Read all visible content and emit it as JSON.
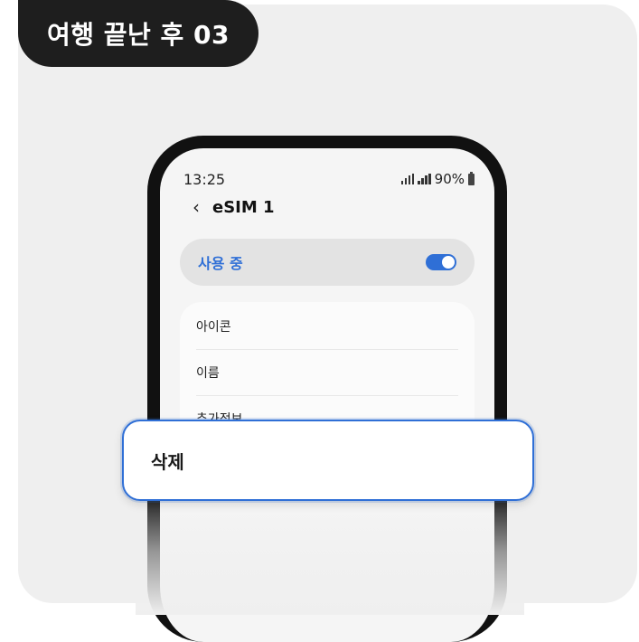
{
  "badge": {
    "text": "여행 끝난 후 03"
  },
  "phone": {
    "status": {
      "time": "13:25",
      "battery": "90%"
    },
    "header": {
      "back_icon": "chevron-left-icon",
      "title": "eSIM 1"
    },
    "toggle": {
      "label": "사용 중",
      "on": true,
      "color": "#2f6fd6"
    },
    "list": [
      {
        "label": "아이콘"
      },
      {
        "label": "이름"
      },
      {
        "label": "추가정보"
      }
    ]
  },
  "popup": {
    "label": "삭제",
    "border_color": "#2f6fd6"
  }
}
